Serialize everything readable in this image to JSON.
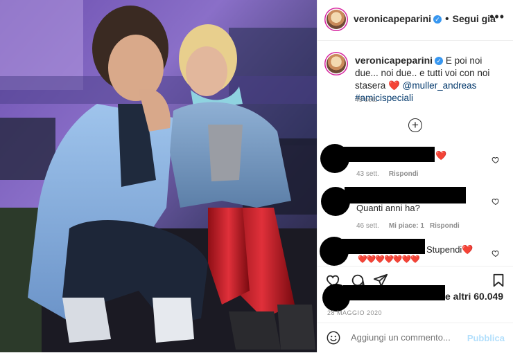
{
  "post": {
    "username": "veronicapeparini",
    "follow_label": "Segui già",
    "separator": "•",
    "more": "•••"
  },
  "caption": {
    "username": "veronicapeparini",
    "text": "E poi noi due... noi due.. e tutti voi con noi stasera",
    "heart": "❤️",
    "mention": "@muller_andreas",
    "hashtag": "#amicispeciali",
    "time": "49 sett."
  },
  "load_more": "+",
  "comments": [
    {
      "text": "❤️",
      "time": "43 sett.",
      "likes": "",
      "reply": "Rispondi"
    },
    {
      "text": "Quanti anni ha?",
      "time": "46 sett.",
      "likes": "Mi piace: 1",
      "reply": "Rispondi"
    },
    {
      "text": "Stupendi❤️",
      "text2": "❤️❤️❤️❤️❤️❤️❤️",
      "time": "",
      "likes": "",
      "reply": ""
    }
  ],
  "likes": {
    "text": "e altri 60.049"
  },
  "date": "28 MAGGIO 2020",
  "comment_box": {
    "placeholder": "Aggiungi un commento...",
    "publish": "Pubblica"
  },
  "colors": {
    "accent": "#0095f6",
    "publish_disabled": "#b2dffc",
    "verified": "#3897f0",
    "border": "#efefef",
    "muted": "#8e8e8e"
  }
}
